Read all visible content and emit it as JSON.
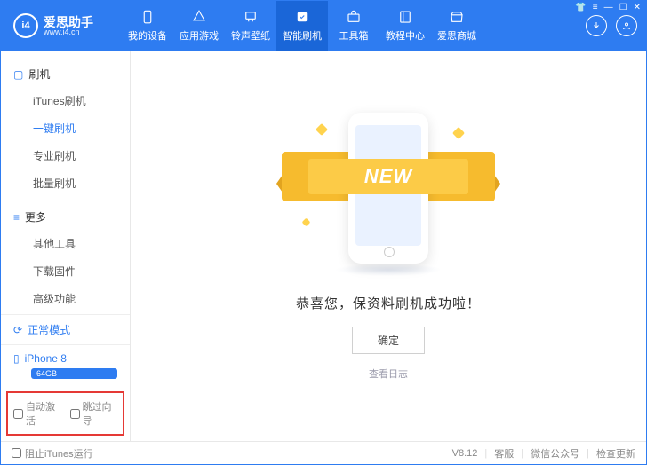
{
  "header": {
    "app_name": "爱思助手",
    "app_url": "www.i4.cn",
    "nav": [
      {
        "label": "我的设备",
        "icon": "phone"
      },
      {
        "label": "应用游戏",
        "icon": "apps"
      },
      {
        "label": "铃声壁纸",
        "icon": "music"
      },
      {
        "label": "智能刷机",
        "icon": "flash",
        "active": true
      },
      {
        "label": "工具箱",
        "icon": "toolbox"
      },
      {
        "label": "教程中心",
        "icon": "book"
      },
      {
        "label": "爱思商城",
        "icon": "shop"
      }
    ]
  },
  "sidebar": {
    "group1": {
      "title": "刷机",
      "items": [
        "iTunes刷机",
        "一键刷机",
        "专业刷机",
        "批量刷机"
      ],
      "active_index": 1
    },
    "group2": {
      "title": "更多",
      "items": [
        "其他工具",
        "下载固件",
        "高级功能"
      ]
    },
    "status_mode": "正常模式",
    "device_name": "iPhone 8",
    "device_storage": "64GB",
    "check_auto_activate": "自动激活",
    "check_skip_guide": "跳过向导"
  },
  "main": {
    "banner_text": "NEW",
    "success_text": "恭喜您，保资料刷机成功啦！",
    "ok_button": "确定",
    "view_log": "查看日志"
  },
  "statusbar": {
    "block_itunes": "阻止iTunes运行",
    "version": "V8.12",
    "support": "客服",
    "wechat": "微信公众号",
    "check_update": "检查更新"
  }
}
